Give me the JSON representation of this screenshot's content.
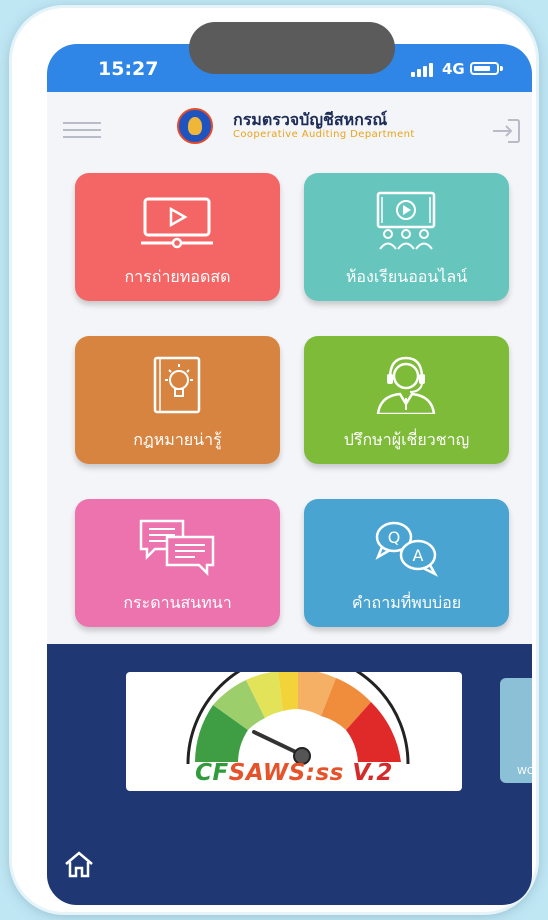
{
  "status_bar": {
    "time": "15:27",
    "network": "4G"
  },
  "header": {
    "org_name_th": "กรมตรวจบัญชีสหกรณ์",
    "org_name_en": "Cooperative Auditing Department"
  },
  "menu_tiles": [
    {
      "label": "การถ่ายทอดสด",
      "icon": "live-video-icon",
      "color": "#f46565"
    },
    {
      "label": "ห้องเรียนออนไลน์",
      "icon": "online-classroom-icon",
      "color": "#66c5bc"
    },
    {
      "label": "กฎหมายน่ารู้",
      "icon": "law-book-icon",
      "color": "#d88441"
    },
    {
      "label": "ปรึกษาผู้เชี่ยวชาญ",
      "icon": "expert-headset-icon",
      "color": "#7dbb38"
    },
    {
      "label": "กระดานสนทนา",
      "icon": "chat-board-icon",
      "color": "#ec73ae"
    },
    {
      "label": "คำถามที่พบบ่อย",
      "icon": "faq-icon",
      "color": "#4aa4d2"
    }
  ],
  "banner": {
    "part1": "CF",
    "part2": "SAWS:ss",
    "part3": " V.2"
  },
  "banner_peek": {
    "text": "WC"
  },
  "colors": {
    "status_bar": "#2f86e6",
    "bottom_panel": "#1f3874",
    "background": "#bfe6f3"
  }
}
